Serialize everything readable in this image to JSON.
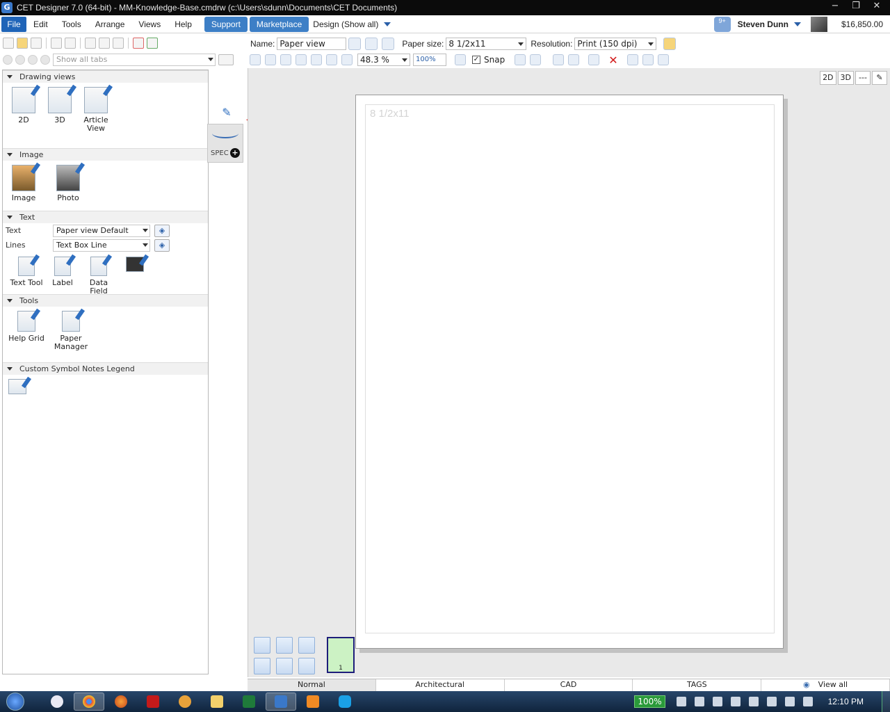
{
  "window": {
    "title": "CET Designer 7.0 (64-bit) - MM-Knowledge-Base.cmdrw (c:\\Users\\sdunn\\Documents\\CET Documents)",
    "minimize": "−",
    "maximize": "❐",
    "close": "✕"
  },
  "menubar": {
    "file": "File",
    "items": [
      "Edit",
      "Tools",
      "Arrange",
      "Views",
      "Help"
    ],
    "support": "Support",
    "marketplace": "Marketplace",
    "design": "Design (Show all)",
    "notifications": "9+",
    "user": "Steven Dunn",
    "balance": "$16,850.00"
  },
  "left": {
    "tab_filter": "Show all tabs",
    "sections": {
      "drawing": {
        "title": "Drawing views",
        "items": [
          "2D",
          "3D",
          "Article View"
        ]
      },
      "image": {
        "title": "Image",
        "items": [
          "Image",
          "Photo"
        ]
      },
      "text": {
        "title": "Text",
        "text_label": "Text",
        "text_value": "Paper view Default",
        "lines_label": "Lines",
        "lines_value": "Text Box Line",
        "items": [
          "Text Tool",
          "Label",
          "Data Field"
        ]
      },
      "tools": {
        "title": "Tools",
        "items": [
          "Help Grid",
          "Paper Manager"
        ]
      },
      "legend": {
        "title": "Custom Symbol Notes Legend"
      }
    },
    "side_tab": {
      "spec": "SPEC",
      "plus": "+"
    },
    "status_glyph": "↕"
  },
  "toolbar": {
    "name_label": "Name:",
    "name_value": "Paper view",
    "paper_size_label": "Paper size:",
    "paper_size_value": "8 1/2x11",
    "resolution_label": "Resolution:",
    "resolution_value": "Print (150 dpi)",
    "zoom_value": "48.3 %",
    "zoom_100": "100%",
    "snap_label": "Snap",
    "snap_checked": "✓",
    "delete": "✕"
  },
  "canvas": {
    "view_buttons": [
      "2D",
      "3D",
      "---"
    ],
    "paper_label": "8 1/2x11",
    "page_number": "1"
  },
  "bottom_tabs": [
    "Normal",
    "Architectural",
    "CAD",
    "TAGS"
  ],
  "bottom_view_all": "View all",
  "taskbar": {
    "battery": "100%",
    "clock": "12:10 PM"
  },
  "colors": {
    "accent": "#1f64b8",
    "arrow": "#e2423a"
  }
}
